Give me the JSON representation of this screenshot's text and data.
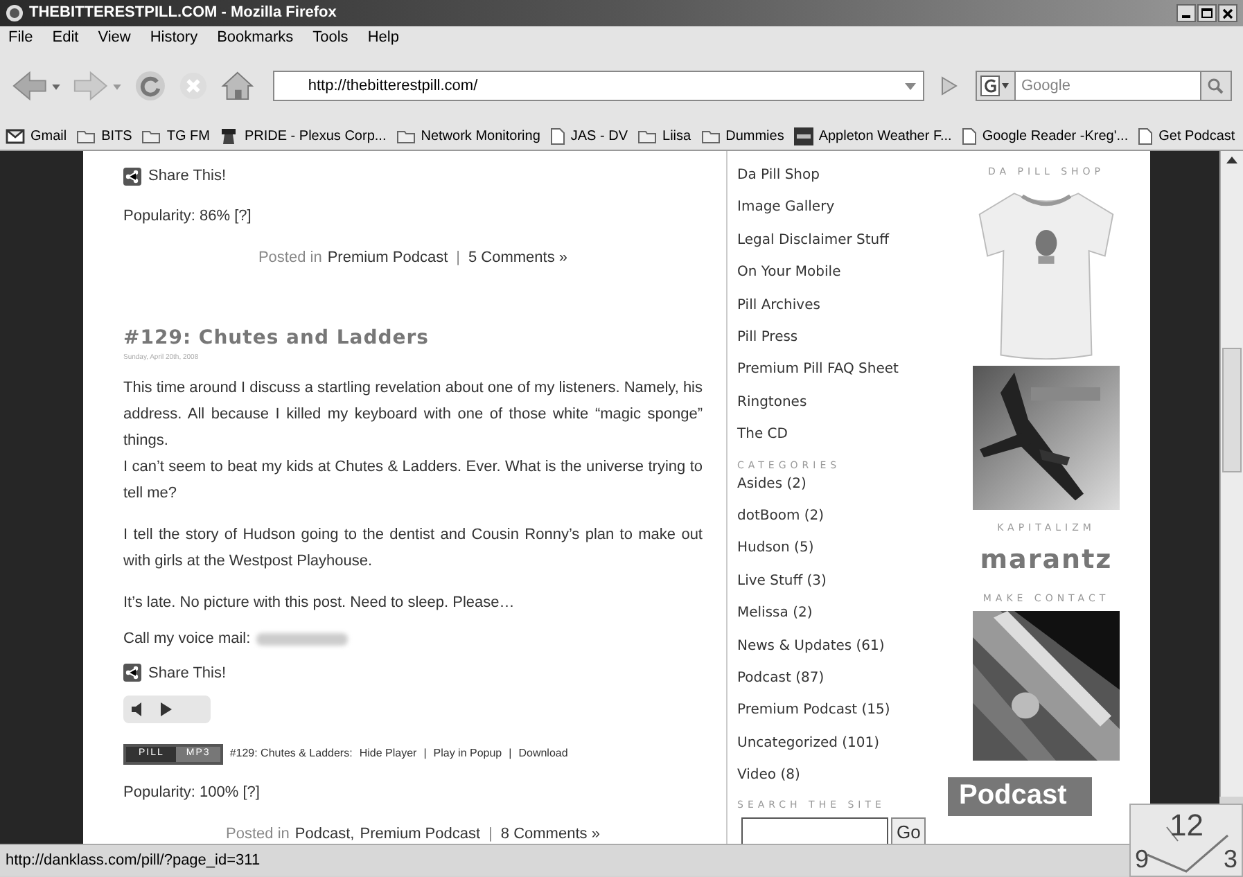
{
  "window": {
    "title": "THEBITTERESTPILL.COM - Mozilla Firefox"
  },
  "menu": [
    "File",
    "Edit",
    "View",
    "History",
    "Bookmarks",
    "Tools",
    "Help"
  ],
  "toolbar": {
    "url": "http://thebitterestpill.com/",
    "search_placeholder": "Google"
  },
  "bookmarks": [
    {
      "label": "Gmail",
      "kind": "mail"
    },
    {
      "label": "BITS",
      "kind": "folder"
    },
    {
      "label": "TG FM",
      "kind": "folder"
    },
    {
      "label": "PRIDE - Plexus Corp...",
      "kind": "site"
    },
    {
      "label": "Network Monitoring",
      "kind": "folder"
    },
    {
      "label": "JAS - DV",
      "kind": "page"
    },
    {
      "label": "Liisa",
      "kind": "folder"
    },
    {
      "label": "Dummies",
      "kind": "folder"
    },
    {
      "label": "Appleton Weather F...",
      "kind": "weather"
    },
    {
      "label": "Google Reader -Kreg'...",
      "kind": "page"
    },
    {
      "label": "Get Podcast",
      "kind": "page"
    }
  ],
  "post_blocks": [
    {
      "kind": "share",
      "text": "Share This!"
    },
    {
      "kind": "text",
      "text": "Popularity: 86% [?]"
    },
    {
      "kind": "posted",
      "prefix": "Posted in",
      "links": [
        "Premium Podcast"
      ],
      "separator": "|",
      "comments": "5 Comments »"
    },
    {
      "kind": "title",
      "text": "#129: Chutes and Ladders"
    },
    {
      "kind": "date",
      "text": "Sunday, April 20th, 2008"
    },
    {
      "kind": "lines",
      "lines": [
        "This time around I discuss a startling revelation about one of my listeners. Namely, his address. All because I killed my keyboard with one of those white “magic sponge” things.",
        "I can’t seem to beat my kids at Chutes & Ladders. Ever. What is the universe trying to tell me?"
      ]
    },
    {
      "kind": "text",
      "text": "I tell the story of Hudson going to the dentist and Cousin Ronny’s plan to make out with girls at the Westpost Playhouse."
    },
    {
      "kind": "text",
      "text": "It’s late. No picture with this post. Need to sleep. Please…"
    },
    {
      "kind": "voicemail",
      "text": "Call my voice mail:"
    },
    {
      "kind": "share",
      "text": "Share This!"
    },
    {
      "kind": "player"
    },
    {
      "kind": "pill",
      "badge": [
        "PILL",
        "MP3"
      ],
      "label": "#129: Chutes & Ladders:",
      "links": [
        "Hide Player",
        "Play in Popup",
        "Download"
      ],
      "separator": "|"
    },
    {
      "kind": "text",
      "text": "Popularity: 100% [?]"
    },
    {
      "kind": "posted",
      "prefix": "Posted in",
      "links": [
        "Podcast,",
        "Premium Podcast"
      ],
      "separator": "|",
      "comments": "8 Comments »"
    }
  ],
  "pages": [
    "Da Pill Shop",
    "Image Gallery",
    "Legal Disclaimer Stuff",
    "On Your Mobile",
    "Pill Archives",
    "Pill Press",
    "Premium Pill FAQ Sheet",
    "Ringtones",
    "The CD"
  ],
  "categories": {
    "heading": "CATEGORIES",
    "items": [
      "Asides (2)",
      "dotBoom (2)",
      "Hudson (5)",
      "Live Stuff (3)",
      "Melissa (2)",
      "News & Updates (61)",
      "Podcast (87)",
      "Premium Podcast (15)",
      "Uncategorized (101)",
      "Video (8)"
    ]
  },
  "search": {
    "heading": "SEARCH THE SITE",
    "button": "Go"
  },
  "widgets": [
    {
      "kind": "heading",
      "text": "DA PILL SHOP"
    },
    {
      "kind": "picture"
    },
    {
      "kind": "picture"
    },
    {
      "kind": "heading",
      "text": "KAPITALIZM"
    },
    {
      "kind": "logo",
      "text": "marantz"
    },
    {
      "kind": "heading",
      "text": "MAKE CONTACT"
    },
    {
      "kind": "picture"
    },
    {
      "kind": "banner",
      "text": "Podcast"
    }
  ],
  "clock": {
    "numbers": [
      "12",
      "9",
      "3"
    ]
  },
  "status_bar": "http://danklass.com/pill/?page_id=311"
}
